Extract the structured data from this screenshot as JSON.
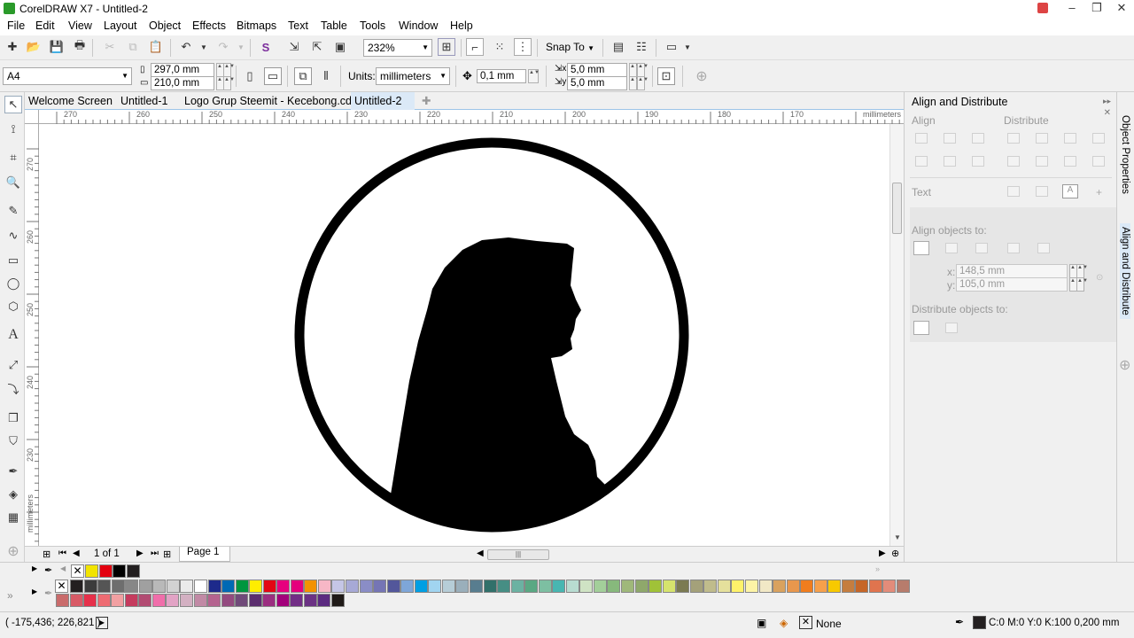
{
  "window": {
    "title": "CorelDRAW X7 - Untitled-2"
  },
  "menu": [
    "File",
    "Edit",
    "View",
    "Layout",
    "Object",
    "Effects",
    "Bitmaps",
    "Text",
    "Table",
    "Tools",
    "Window",
    "Help"
  ],
  "toolbar": {
    "zoom": "232%",
    "snap_to": "Snap To"
  },
  "property_bar": {
    "page_size": "A4",
    "height": "297,0 mm",
    "width": "210,0 mm",
    "units_label": "Units:",
    "units": "millimeters",
    "nudge": "0,1 mm",
    "dup_x": "5,0 mm",
    "dup_y": "5,0 mm"
  },
  "tabs": [
    "Welcome Screen",
    "Untitled-1",
    "Logo Grup Steemit - Kecebong.cdr",
    "Untitled-2"
  ],
  "ruler": {
    "h_ticks": [
      "270",
      "260",
      "250",
      "240",
      "230",
      "220",
      "210",
      "200",
      "190",
      "180",
      "170"
    ],
    "h_unit": "millimeters",
    "v_ticks": [
      "270",
      "260",
      "250",
      "240",
      "230"
    ],
    "v_unit": "millimeters"
  },
  "page_nav": {
    "counter": "1 of 1",
    "page": "Page 1"
  },
  "docker": {
    "title": "Align and Distribute",
    "align": "Align",
    "distribute": "Distribute",
    "text": "Text",
    "align_to": "Align objects to:",
    "x_label": "x:",
    "x_value": "148,5 mm",
    "y_label": "y:",
    "y_value": "105,0 mm",
    "distribute_to": "Distribute objects to:"
  },
  "side_tabs": [
    "Object Properties",
    "Align and Distribute"
  ],
  "doc_palette": [
    "#f2e400",
    "#e3000f",
    "#000000",
    "#231f20"
  ],
  "palette_row1": [
    "#231f20",
    "#3c3c3c",
    "#555555",
    "#6e6e6e",
    "#878787",
    "#a0a0a0",
    "#b9b9b9",
    "#d2d2d2",
    "#ebebeb",
    "#ffffff",
    "#1d2a8b",
    "#0069b4",
    "#00963f",
    "#ffed00",
    "#e30613",
    "#e6007e",
    "#e5007d",
    "#f39200",
    "#f7b7c6",
    "#c5c6e6",
    "#a7a9d6",
    "#8a8dc6",
    "#7575b5",
    "#53579b",
    "#7ea6d8",
    "#009fe3",
    "#a1d4f0",
    "#b6cdd7",
    "#9aafbb",
    "#587d8f",
    "#31706a",
    "#468e84",
    "#6bb2a2",
    "#5aa883",
    "#7dbfa2",
    "#48b6b1",
    "#b8dcd1",
    "#cfe3c4",
    "#a3cf9a",
    "#87b97c",
    "#9fb87a",
    "#8fa86b",
    "#a0c238",
    "#d6e36d",
    "#7b7a52",
    "#a4a17a",
    "#c0bc8c",
    "#e5e09c",
    "#fff26a",
    "#fdf4a6",
    "#f1e8c6",
    "#d9a25e",
    "#e8974d",
    "#f07d1e",
    "#f6a04b",
    "#f7c900",
    "#c57d3f",
    "#c66628",
    "#e0744e",
    "#e38c7a",
    "#b77c6c"
  ],
  "palette_row2": [
    "#c96b6b",
    "#d85a66",
    "#e6304a",
    "#ee6b72",
    "#f2a0a2",
    "#c53b5e",
    "#b24b72",
    "#f06eaa",
    "#e2a3c5",
    "#d3b0c2",
    "#c189a5",
    "#b4638f",
    "#934a7f",
    "#704a79",
    "#5c2e6f",
    "#9b2e80",
    "#a3007b",
    "#722e86",
    "#6b3284",
    "#5b2a80",
    "#1f1a17"
  ],
  "status": {
    "coords": "( -175,436; 226,821 )",
    "fill": "None",
    "outline": "C:0 M:0 Y:0 K:100  0,200 mm"
  }
}
